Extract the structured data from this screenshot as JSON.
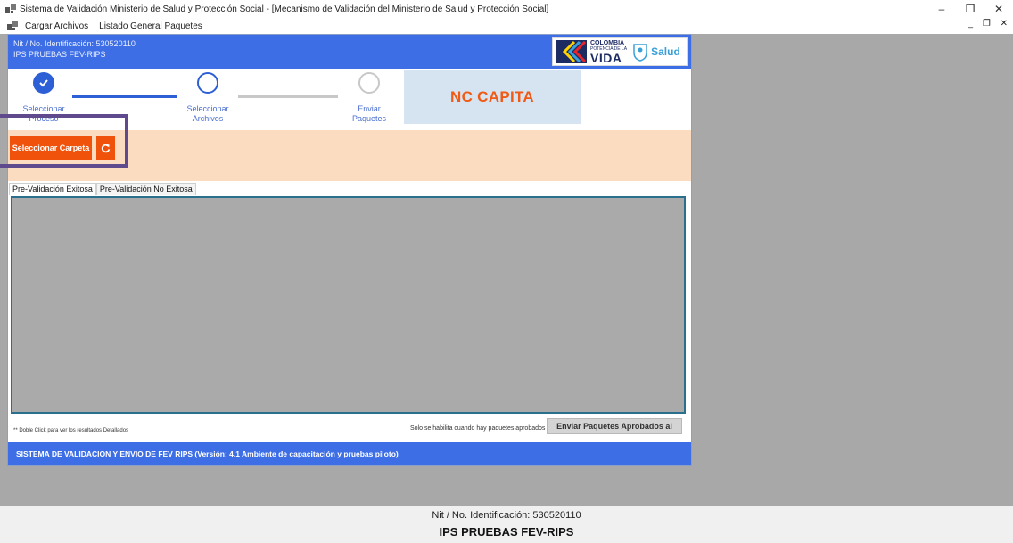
{
  "window": {
    "title": "Sistema de Validación Ministerio de Salud y Protección Social - [Mecanismo de Validación del Ministerio de Salud y Protección Social]",
    "controls": {
      "minimize": "–",
      "maximize": "❐",
      "close": "✕"
    }
  },
  "menu": {
    "items": [
      "Cargar Archivos",
      "Listado General Paquetes"
    ],
    "mdi_controls": "_ ❐ ✕"
  },
  "header": {
    "nit": "Nit / No. Identificación: 530520110",
    "ips": "IPS PRUEBAS FEV-RIPS",
    "logo": {
      "colombia": "COLOMBIA",
      "potencia": "POTENCIA DE LA",
      "vida": "VIDA",
      "salud": "Salud"
    }
  },
  "stepper": {
    "steps": [
      {
        "label_line1": "Seleccionar",
        "label_line2": "Proceso",
        "state": "done"
      },
      {
        "label_line1": "Seleccionar",
        "label_line2": "Archivos",
        "state": "current"
      },
      {
        "label_line1": "Enviar",
        "label_line2": "Paquetes",
        "state": "pending"
      }
    ],
    "colors": {
      "active": "#2d5fd6",
      "pending": "#c8c8c8"
    }
  },
  "nc_label": "NC CAPITA",
  "actions": {
    "select_folder": "Seleccionar Carpeta",
    "refresh_icon": "refresh-icon"
  },
  "tabs": [
    {
      "label": "Pre-Validación Exitosa",
      "active": true
    },
    {
      "label": "Pre-Validación No Exitosa",
      "active": false
    }
  ],
  "grid_hint": "** Doble Click para ver los resultados Detallados",
  "send_note": "Solo se habilita cuando hay paquetes aprobados",
  "send_button": "Enviar Paquetes Aprobados al",
  "footer": "SISTEMA DE VALIDACION Y ENVIO DE FEV RIPS  (Versión: 4.1 Ambiente de capacitación y pruebas piloto)",
  "status": {
    "nit": "Nit / No. Identificación: 530520110",
    "ips": "IPS PRUEBAS FEV-RIPS"
  },
  "theme": {
    "brand_blue": "#3d6ee6",
    "accent_orange": "#f0520c",
    "band": "#fcdcc0",
    "highlight": "#5e4a8c"
  }
}
